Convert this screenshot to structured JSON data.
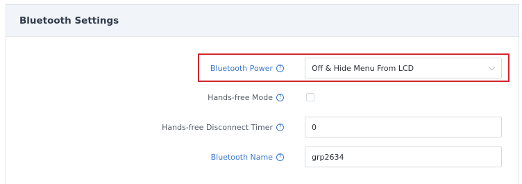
{
  "panel": {
    "title": "Bluetooth Settings"
  },
  "fields": {
    "bluetooth_power": {
      "label": "Bluetooth Power",
      "value": "Off & Hide Menu From LCD",
      "help_icon": "help-icon"
    },
    "handsfree_mode": {
      "label": "Hands-free Mode",
      "checked": false,
      "help_icon": "help-icon"
    },
    "handsfree_disconnect_timer": {
      "label": "Hands-free Disconnect Timer",
      "value": "0",
      "help_icon": "help-icon"
    },
    "bluetooth_name": {
      "label": "Bluetooth Name",
      "value": "grp2634",
      "help_icon": "help-icon"
    }
  },
  "help_glyph": "?",
  "colors": {
    "link_blue": "#3a78d0",
    "label_gray": "#555c66",
    "highlight_red": "#d3262d",
    "header_bg": "#f1f4f8"
  }
}
